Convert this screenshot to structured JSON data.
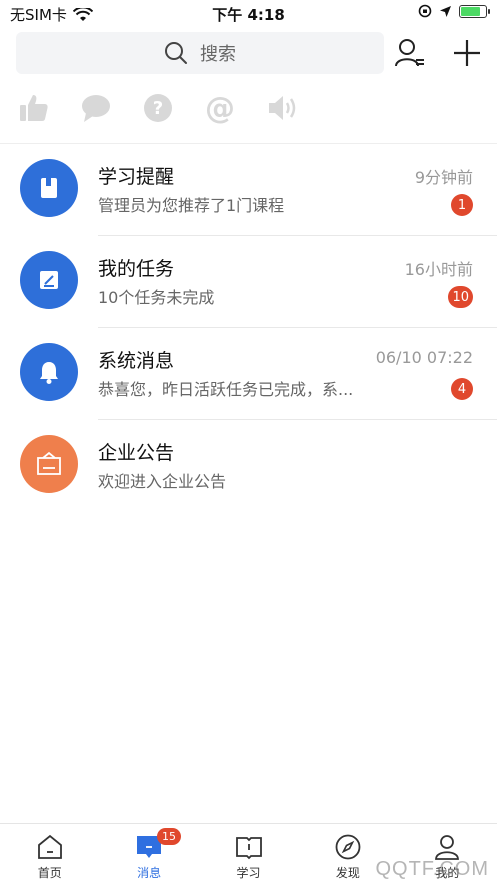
{
  "status_bar": {
    "carrier": "无SIM卡",
    "time": "下午 4:18"
  },
  "search": {
    "placeholder": "搜索"
  },
  "quick_actions": [
    {
      "icon": "thumbs-up-icon"
    },
    {
      "icon": "chat-bubble-icon"
    },
    {
      "icon": "question-icon"
    },
    {
      "icon": "at-icon"
    },
    {
      "icon": "speaker-icon"
    }
  ],
  "messages": [
    {
      "title": "学习提醒",
      "subtitle": "管理员为您推荐了1门课程",
      "time": "9分钟前",
      "badge": "1",
      "color": "#2e6fd9",
      "icon": "book-icon"
    },
    {
      "title": "我的任务",
      "subtitle": "10个任务未完成",
      "time": "16小时前",
      "badge": "10",
      "color": "#2e6fd9",
      "icon": "task-icon"
    },
    {
      "title": "系统消息",
      "subtitle": "恭喜您，昨日活跃任务已完成，系...",
      "time": "06/10 07:22",
      "badge": "4",
      "color": "#2e6fd9",
      "icon": "bell-icon"
    },
    {
      "title": "企业公告",
      "subtitle": "欢迎进入企业公告",
      "time": "",
      "badge": "",
      "color": "#ef7f4c",
      "icon": "announcement-icon"
    }
  ],
  "tabs": [
    {
      "label": "首页",
      "icon": "home-icon"
    },
    {
      "label": "消息",
      "icon": "message-icon",
      "badge": "15",
      "active": true
    },
    {
      "label": "学习",
      "icon": "learn-book-icon"
    },
    {
      "label": "发现",
      "icon": "compass-icon"
    },
    {
      "label": "我的",
      "icon": "profile-icon"
    }
  ],
  "watermark": "QQTF.COM"
}
